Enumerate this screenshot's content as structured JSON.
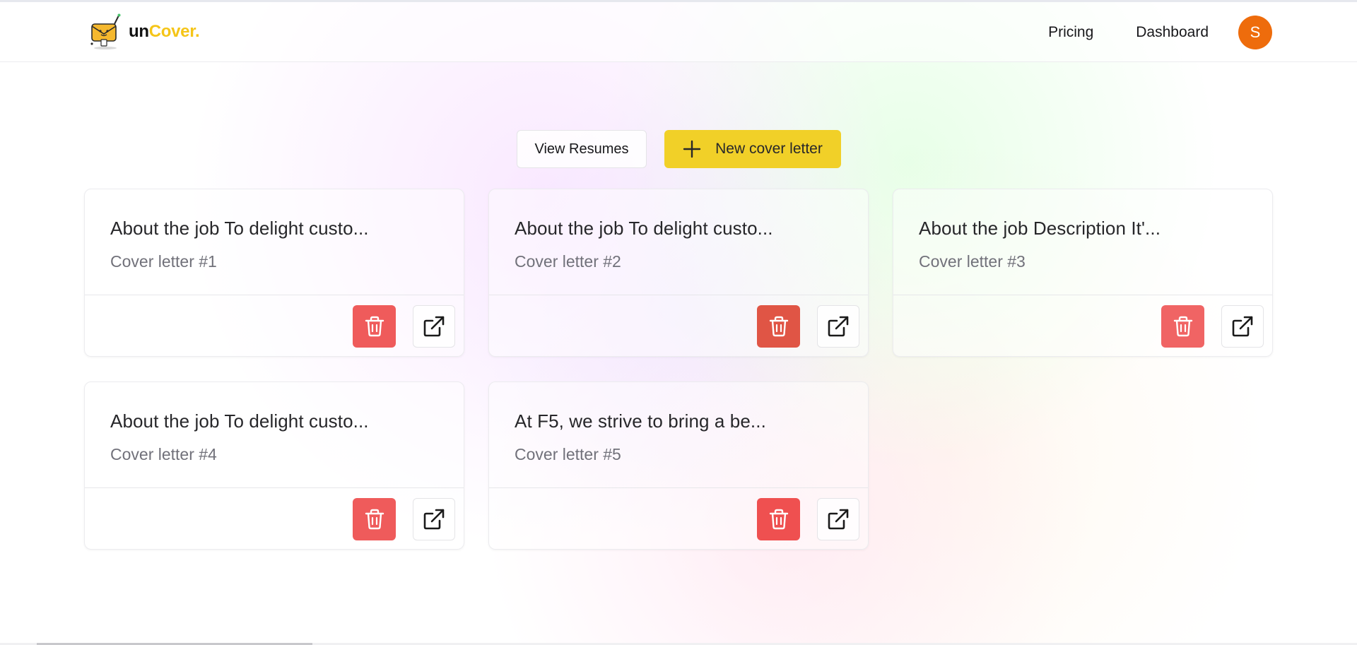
{
  "brand": {
    "name_part1": "un",
    "name_part2": "Cover.",
    "accent_color": "#f5c518"
  },
  "nav": {
    "pricing": "Pricing",
    "dashboard": "Dashboard",
    "avatar_initial": "S",
    "avatar_color": "#ee6c0c"
  },
  "actions": {
    "view_resumes": "View Resumes",
    "new_cover_letter": "New cover letter",
    "primary_color": "#f1d028"
  },
  "cards": [
    {
      "title": "About the job To delight custo...",
      "subtitle": "Cover letter #1"
    },
    {
      "title": "About the job To delight custo...",
      "subtitle": "Cover letter #2"
    },
    {
      "title": "About the job Description It'...",
      "subtitle": "Cover letter #3"
    },
    {
      "title": "About the job To delight custo...",
      "subtitle": "Cover letter #4"
    },
    {
      "title": "At F5, we strive to bring a be...",
      "subtitle": "Cover letter #5"
    }
  ],
  "card_actions": {
    "delete_icon": "trash-icon",
    "open_icon": "external-link-icon",
    "delete_color": "#ef5b5b"
  }
}
